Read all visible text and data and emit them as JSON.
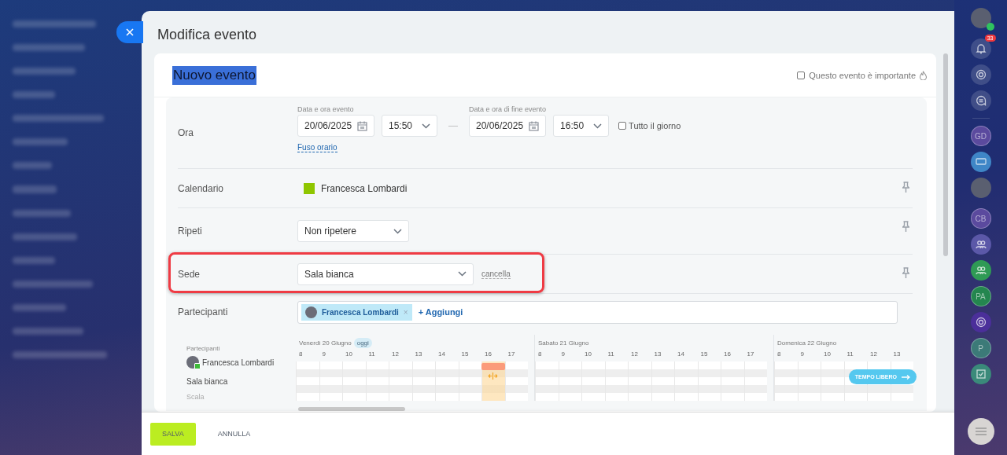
{
  "panel": {
    "title": "Modifica evento"
  },
  "event": {
    "name": "Nuovo evento",
    "important": {
      "label": "Questo evento è importante",
      "checked": false
    }
  },
  "time": {
    "label": "Ora",
    "start_caption": "Data e ora evento",
    "start_date": "20/06/2025",
    "start_time": "15:50",
    "range_separator": "—",
    "end_caption": "Data e ora di fine evento",
    "end_date": "20/06/2025",
    "end_time": "16:50",
    "all_day": {
      "label": "Tutto il giorno",
      "checked": false
    },
    "timezone_link": "Fuso orario"
  },
  "calendar": {
    "label": "Calendario",
    "value": "Francesca Lombardi",
    "color": "#8fc600"
  },
  "repeat": {
    "label": "Ripeti",
    "value": "Non ripetere"
  },
  "location": {
    "label": "Sede",
    "value": "Sala bianca",
    "clear_link": "cancella",
    "highlighted": true
  },
  "participants": {
    "label": "Partecipanti",
    "chips": [
      {
        "name": "Francesca Lombardi",
        "remove_glyph": "×"
      }
    ],
    "add_link": "+ Aggiungi"
  },
  "planner": {
    "list_heading": "Partecipanti",
    "rows": [
      {
        "name": "Francesca Lombardi",
        "kind": "person"
      },
      {
        "name": "Sala bianca",
        "kind": "room"
      }
    ],
    "days": [
      {
        "label": "Venerdì 20 Giugno",
        "badge": "oggi",
        "hours": [
          {
            "label": "8",
            "busy": false
          },
          {
            "label": "9",
            "busy": false
          },
          {
            "label": "10",
            "busy": false
          },
          {
            "label": "11",
            "busy": false
          },
          {
            "label": "12",
            "busy": false
          },
          {
            "label": "13",
            "busy": false
          },
          {
            "label": "14",
            "busy": false
          },
          {
            "label": "15",
            "busy": false
          },
          {
            "label": "16",
            "busy": true
          },
          {
            "label": "17",
            "busy": false
          }
        ]
      },
      {
        "label": "Sabato 21 Giugno",
        "hours": [
          {
            "label": "8",
            "busy": false
          },
          {
            "label": "9",
            "busy": false
          },
          {
            "label": "10",
            "busy": false
          },
          {
            "label": "11",
            "busy": false
          },
          {
            "label": "12",
            "busy": false
          },
          {
            "label": "13",
            "busy": false
          },
          {
            "label": "14",
            "busy": false
          },
          {
            "label": "15",
            "busy": false
          },
          {
            "label": "16",
            "busy": false
          },
          {
            "label": "17",
            "busy": false
          }
        ]
      },
      {
        "label": "Domenica 22 Giugno",
        "hours": [
          {
            "label": "8",
            "busy": false
          },
          {
            "label": "9",
            "busy": false
          },
          {
            "label": "10",
            "busy": false
          },
          {
            "label": "11",
            "busy": false
          },
          {
            "label": "12",
            "busy": false
          },
          {
            "label": "13",
            "busy": false
          }
        ]
      }
    ],
    "free_time_button": "TEMPO LIBERO",
    "scale_label": "Scala"
  },
  "footer": {
    "buttons": [
      {
        "label": "SALVA",
        "kind": "primary"
      },
      {
        "label": "ANNULLA",
        "kind": "plain"
      }
    ]
  },
  "right_bar": {
    "items": [
      {
        "kind": "avatar"
      },
      {
        "kind": "bell",
        "badge": "33"
      },
      {
        "kind": "target"
      },
      {
        "kind": "chat"
      },
      {
        "kind": "divider"
      },
      {
        "kind": "initials",
        "text": "GD",
        "color": "#5b4a9e"
      },
      {
        "kind": "chat-group"
      },
      {
        "kind": "avatar"
      },
      {
        "kind": "initials",
        "text": "CB",
        "color": "#5b4a9e"
      },
      {
        "kind": "group",
        "color": "#5b58a8"
      },
      {
        "kind": "group",
        "color": "#2f9a55"
      },
      {
        "kind": "initials",
        "text": "PA",
        "color": "#24864f"
      },
      {
        "kind": "target",
        "color": "#4b2f9a"
      },
      {
        "kind": "initials",
        "text": "P",
        "color": "#3c7a78"
      },
      {
        "kind": "task",
        "color": "#3a8a7a"
      }
    ]
  }
}
